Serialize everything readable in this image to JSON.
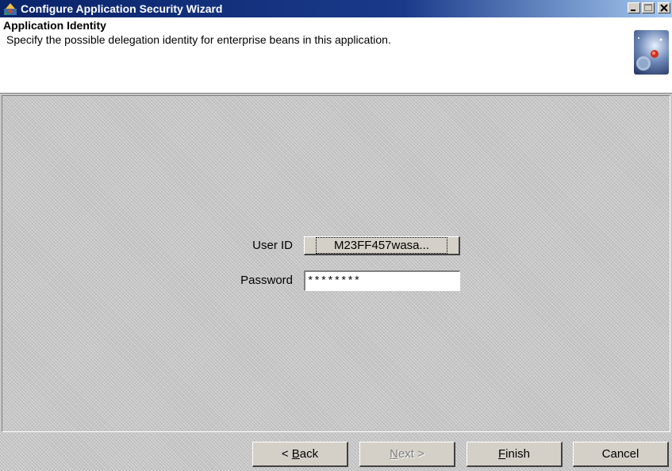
{
  "window": {
    "title": "Configure Application Security Wizard",
    "controls": {
      "minimize": "_",
      "maximize": "□",
      "close": "✕"
    }
  },
  "header": {
    "title": "Application Identity",
    "description": "Specify the possible delegation identity for enterprise beans in this application."
  },
  "form": {
    "user_id_label": "User ID",
    "user_id_value": "M23FF457wasa...",
    "password_label": "Password",
    "password_value": "********"
  },
  "buttons": {
    "back_prefix": "< ",
    "back_mnemonic": "B",
    "back_rest": "ack",
    "next_mnemonic": "N",
    "next_rest": "ext >",
    "finish_mnemonic": "F",
    "finish_rest": "inish",
    "cancel": "Cancel"
  },
  "colors": {
    "titlebar_start": "#0a246a",
    "titlebar_end": "#a6caf0",
    "panel_bg": "#c4c4c4",
    "header_bg": "#ffffff"
  }
}
